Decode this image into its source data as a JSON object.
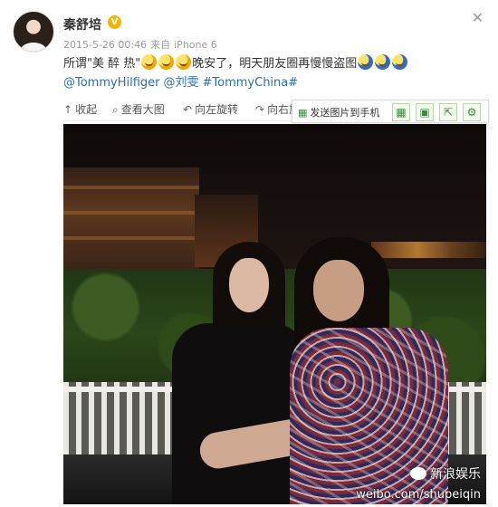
{
  "post": {
    "username": "秦舒培",
    "vip_mark": "V",
    "timestamp": "2015-5-26 00:46",
    "source_prefix": "来自",
    "source": "iPhone 6",
    "text_part1": "所谓\"美 醉 热\"",
    "text_part2": "晚安了，明天朋友圈再慢慢盗图",
    "mentions": [
      "@TommyHilfiger",
      "@刘雯",
      "#TommyChina#"
    ]
  },
  "toolbar": {
    "collapse_icon": "arrow-up-icon",
    "collapse": "收起",
    "view_large_icon": "magnifier-icon",
    "view_large": "查看大图",
    "rotate_left_icon": "rotate-left-icon",
    "rotate_left": "向左旋转",
    "rotate_right_icon": "rotate-right-icon",
    "rotate_right": "向右旋"
  },
  "phone_bar": {
    "send_to_phone_icon": "phone-grid-icon",
    "send_to_phone": "发送图片到手机",
    "icons": [
      "grid-icon",
      "save-icon",
      "share-icon",
      "gear-icon"
    ]
  },
  "photo": {
    "watermark_logo": "新浪娱乐",
    "watermark_url": "weibo.com/shupeiqin"
  },
  "colors": {
    "link": "#2f6ea8",
    "vip_badge": "#f6b300",
    "meta_gray": "#999999",
    "phone_bar_green": "#3a8c3a"
  }
}
